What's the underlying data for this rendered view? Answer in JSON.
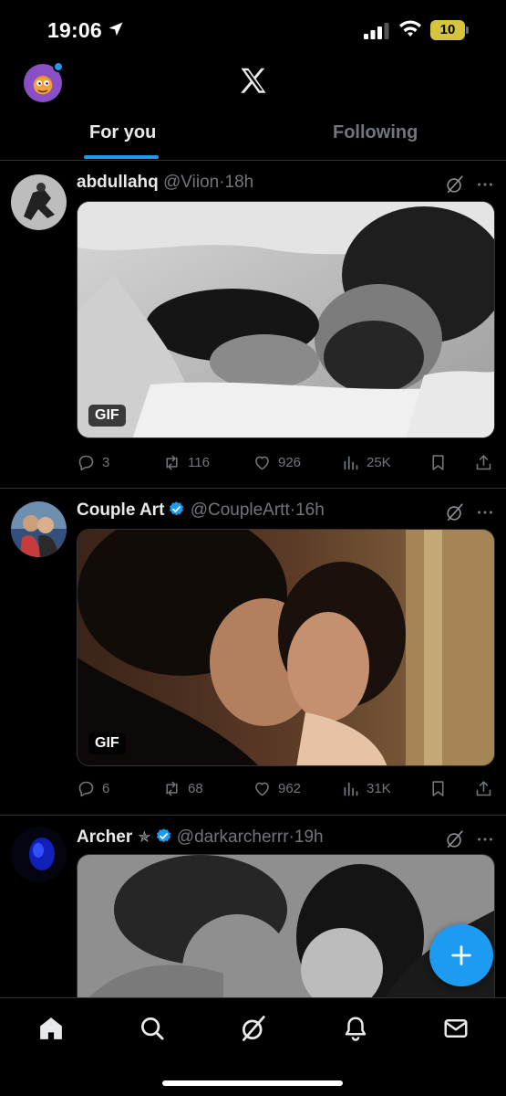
{
  "status_bar": {
    "time": "19:06",
    "battery": "10",
    "icons": [
      "location-arrow-icon",
      "signal-icon",
      "wifi-icon",
      "battery-icon"
    ]
  },
  "header": {
    "logo": "X",
    "avatar_icon": "profile-avatar",
    "notification_dot": true
  },
  "tabs": [
    {
      "label": "For you",
      "active": true
    },
    {
      "label": "Following",
      "active": false
    }
  ],
  "accent_color": "#1d9bf0",
  "posts": [
    {
      "author": "abdullahq",
      "handle": "@Viion",
      "separator": "·",
      "time": "18h",
      "verified": false,
      "media_badge": "GIF",
      "replies": "3",
      "reposts": "116",
      "likes": "926",
      "views": "25K"
    },
    {
      "author": "Couple Art",
      "handle": "@CoupleArtt",
      "separator": "·",
      "time": "16h",
      "verified": true,
      "media_badge": "GIF",
      "replies": "6",
      "reposts": "68",
      "likes": "962",
      "views": "31K"
    },
    {
      "author": "Archer",
      "star": "✯",
      "handle": "@darkarcherrr",
      "separator": "·",
      "time": "19h",
      "verified": true
    }
  ],
  "fab": {
    "icon": "plus-icon"
  },
  "bottom_nav": [
    "home-icon",
    "search-icon",
    "grok-icon",
    "bell-icon",
    "mail-icon"
  ]
}
